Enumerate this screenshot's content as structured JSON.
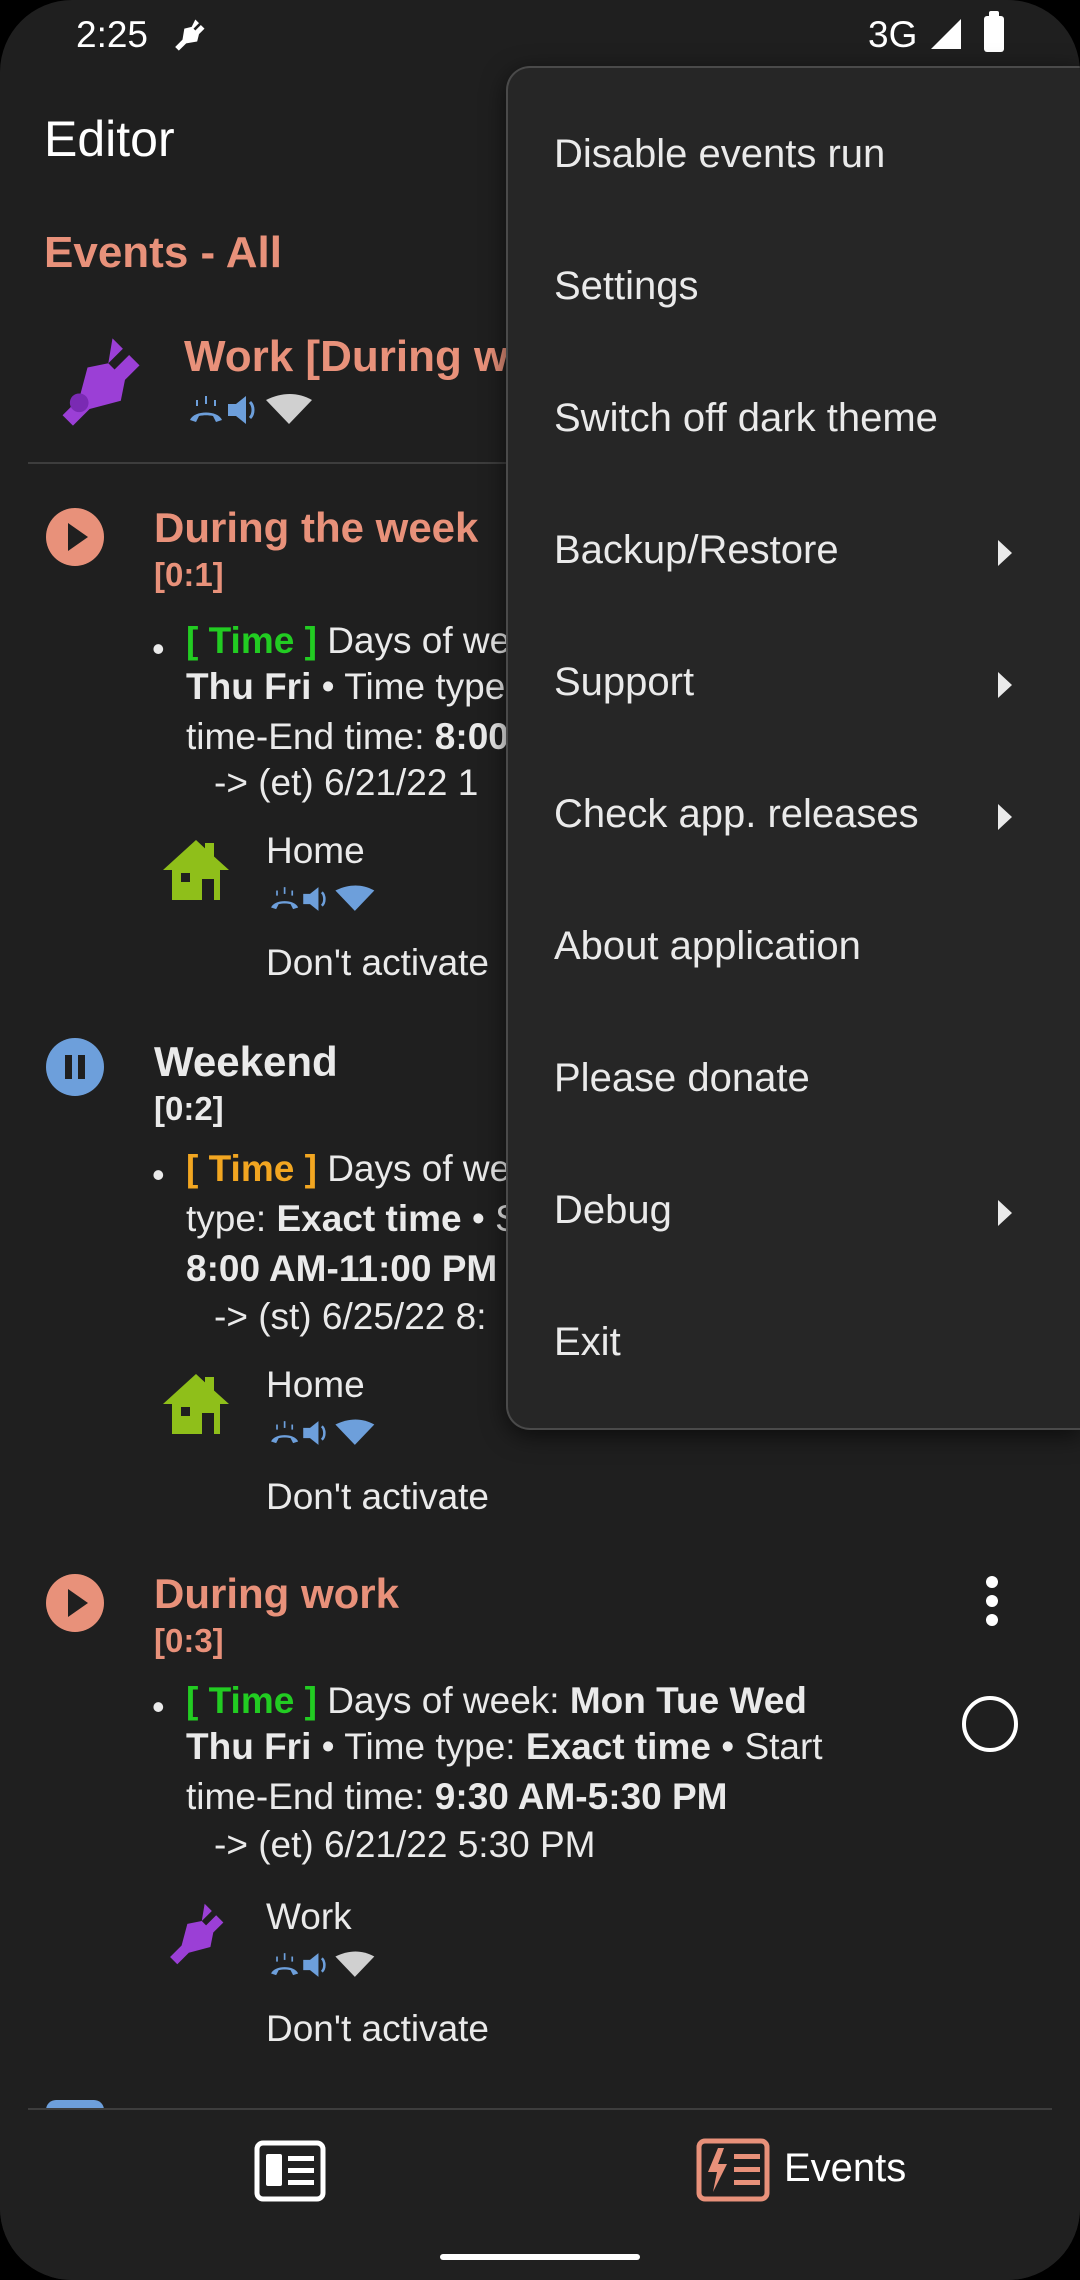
{
  "status_bar": {
    "time": "2:25",
    "network": "3G",
    "icons": [
      "plug-icon",
      "signal-icon",
      "battery-icon"
    ]
  },
  "header": {
    "title": "Editor",
    "section": "Events - All"
  },
  "selected_profile": {
    "name": "Work [During wo",
    "icon": "plug-icon",
    "icon_color": "#9b3fd6"
  },
  "events": [
    {
      "title": "During the week",
      "id": "[0:1]",
      "state": "running",
      "condition_bracket": "[ Time ]",
      "lines": [
        {
          "t1": "Days of we"
        },
        {
          "b1": "Thu Fri",
          "t2": " • Time type"
        },
        {
          "t1": "time-End time: ",
          "b1": "8:00"
        }
      ],
      "sub": "-> (et) 6/21/22 1",
      "profile": {
        "name": "Home",
        "activate": "Don't activate"
      }
    },
    {
      "title": "Weekend",
      "id": "[0:2]",
      "state": "paused",
      "condition_bracket": "[ Time ]",
      "lines": [
        {
          "t1": "Days of we"
        },
        {
          "t1": "type: ",
          "b1": "Exact time",
          "t2": " • S"
        },
        {
          "b1": "8:00 AM-11:00 PM"
        }
      ],
      "sub": "-> (st) 6/25/22 8:",
      "profile": {
        "name": "Home",
        "activate": "Don't activate"
      }
    },
    {
      "title": "During work",
      "id": "[0:3]",
      "state": "running",
      "condition_bracket": "[ Time ]",
      "lines": [
        {
          "t1": "Days of week: ",
          "b1": "Mon Tue Wed"
        },
        {
          "b1": "Thu Fri",
          "t2": " • Time type: ",
          "b2": "Exact time",
          "t3": " • Start"
        },
        {
          "t1": "time-End time: ",
          "b1": "9:30 AM-5:30 PM"
        }
      ],
      "sub": "-> (et) 6/21/22 5:30 PM",
      "profile": {
        "name": "Work",
        "activate": "Don't activate"
      }
    }
  ],
  "menu": {
    "items": [
      {
        "label": "Disable events run",
        "submenu": false
      },
      {
        "label": "Settings",
        "submenu": false
      },
      {
        "label": "Switch off dark theme",
        "submenu": false
      },
      {
        "label": "Backup/Restore",
        "submenu": true
      },
      {
        "label": "Support",
        "submenu": true
      },
      {
        "label": "Check app. releases",
        "submenu": true
      },
      {
        "label": "About application",
        "submenu": false
      },
      {
        "label": "Please donate",
        "submenu": false
      },
      {
        "label": "Debug",
        "submenu": true
      },
      {
        "label": "Exit",
        "submenu": false
      }
    ]
  },
  "bottom_nav": {
    "events_label": "Events"
  },
  "colors": {
    "accent": "#e8917a",
    "paused": "#6d9fdb",
    "time_active": "#22cc22",
    "time_paused": "#f2a621",
    "home_icon": "#8fbf1a",
    "work_icon": "#9b3fd6"
  }
}
